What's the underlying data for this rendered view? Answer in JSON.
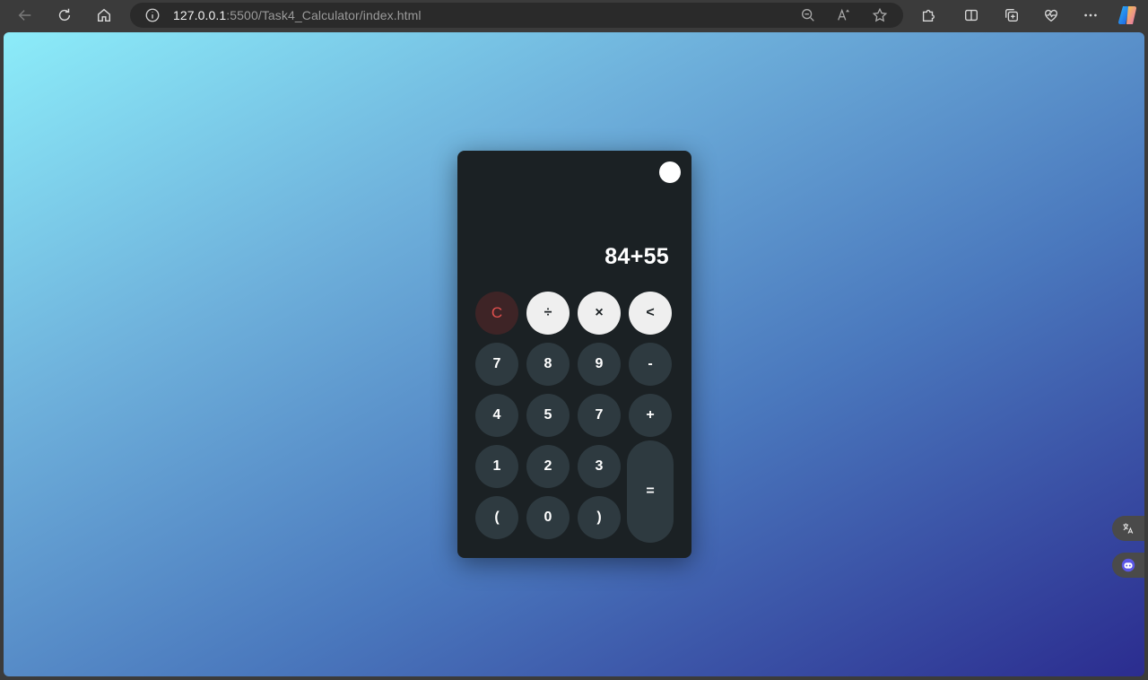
{
  "browser": {
    "url_host": "127.0.0.1",
    "url_rest": ":5500/Task4_Calculator/index.html"
  },
  "calculator": {
    "display": "84+55",
    "keys": {
      "clear": "C",
      "divide": "÷",
      "multiply": "×",
      "backspace": "<",
      "seven": "7",
      "eight": "8",
      "nine": "9",
      "minus": "-",
      "four": "4",
      "five": "5",
      "seven_b": "7",
      "plus": "+",
      "one": "1",
      "two": "2",
      "three": "3",
      "equals": "=",
      "lparen": "(",
      "zero": "0",
      "rparen": ")"
    }
  },
  "colors": {
    "calculator_body": "#1b2124",
    "key_dark": "#2e3a40",
    "key_light": "#efefef",
    "clear_text": "#e0504e",
    "gradient_start": "#8cecf9",
    "gradient_end": "#2b2c8f"
  },
  "icons": {
    "back": "arrow-left-icon",
    "refresh": "refresh-icon",
    "home": "home-icon",
    "info": "info-icon",
    "zoom": "zoom-out-icon",
    "read_aloud": "read-aloud-icon",
    "favorite": "star-icon",
    "extensions": "puzzle-icon",
    "split": "split-screen-icon",
    "collections": "collections-icon",
    "health": "heartbeat-icon",
    "more": "more-icon",
    "copilot": "copilot-icon",
    "translate": "translate-icon",
    "assistant": "assistant-icon"
  }
}
